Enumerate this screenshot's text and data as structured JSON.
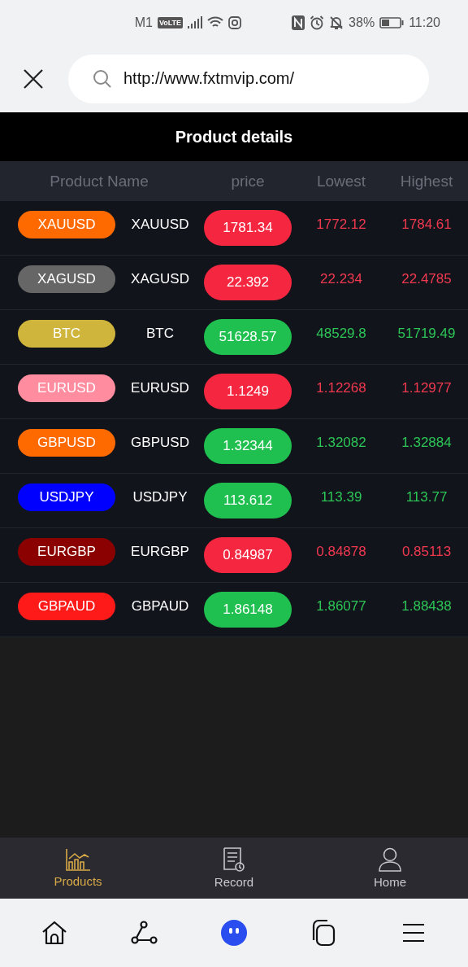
{
  "status_bar": {
    "carrier": "M1",
    "network_badge": "VoLTE",
    "battery": "38%",
    "time": "11:20"
  },
  "address_bar": {
    "url": "http://www.fxtmvip.com/"
  },
  "title": "Product details",
  "table": {
    "columns": [
      "Product Name",
      "price",
      "Lowest",
      "Highest"
    ],
    "rows": [
      {
        "tag": "XAUUSD",
        "color": "#ff6a00",
        "name": "XAUUSD",
        "price": "1781.34",
        "lowest": "1772.12",
        "highest": "1784.61",
        "rising": false
      },
      {
        "tag": "XAGUSD",
        "color": "#666666",
        "name": "XAGUSD",
        "price": "22.392",
        "lowest": "22.234",
        "highest": "22.4785",
        "rising": false
      },
      {
        "tag": "BTC",
        "color": "#cfb53b",
        "name": "BTC",
        "price": "51628.57",
        "lowest": "48529.8",
        "highest": "51719.49",
        "rising": true
      },
      {
        "tag": "EURUSD",
        "color": "#ff8c9f",
        "name": "EURUSD",
        "price": "1.1249",
        "lowest": "1.12268",
        "highest": "1.12977",
        "rising": false
      },
      {
        "tag": "GBPUSD",
        "color": "#ff6a00",
        "name": "GBPUSD",
        "price": "1.32344",
        "lowest": "1.32082",
        "highest": "1.32884",
        "rising": true
      },
      {
        "tag": "USDJPY",
        "color": "#0000ff",
        "name": "USDJPY",
        "price": "113.612",
        "lowest": "113.39",
        "highest": "113.77",
        "rising": true
      },
      {
        "tag": "EURGBP",
        "color": "#8b0000",
        "name": "EURGBP",
        "price": "0.84987",
        "lowest": "0.84878",
        "highest": "0.85113",
        "rising": false
      },
      {
        "tag": "GBPAUD",
        "color": "#ff1a1a",
        "name": "GBPAUD",
        "price": "1.86148",
        "lowest": "1.86077",
        "highest": "1.88438",
        "rising": true
      }
    ]
  },
  "tab_bar": [
    {
      "label": "Products",
      "selected": true
    },
    {
      "label": "Record",
      "selected": false
    },
    {
      "label": "Home",
      "selected": false
    }
  ]
}
